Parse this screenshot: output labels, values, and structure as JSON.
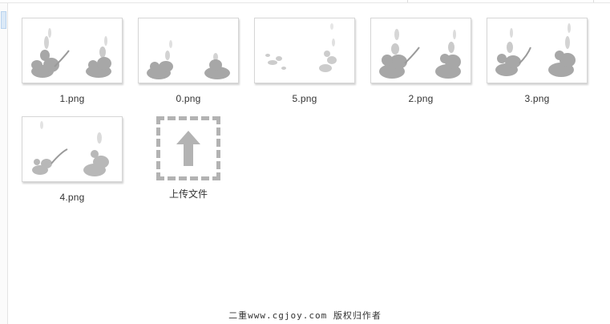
{
  "files": [
    {
      "name": "1.png"
    },
    {
      "name": "0.png"
    },
    {
      "name": "5.png"
    },
    {
      "name": "2.png"
    },
    {
      "name": "3.png"
    },
    {
      "name": "4.png"
    }
  ],
  "upload": {
    "label": "上传文件",
    "icon": "upload-arrow-icon"
  },
  "footer": {
    "watermark": "二重www.cgjoy.com 版权归作者"
  },
  "colors": {
    "upload_border": "#b3b3b3",
    "thumb_border": "#d6d6d6",
    "smoke": "#8a8a8a"
  }
}
